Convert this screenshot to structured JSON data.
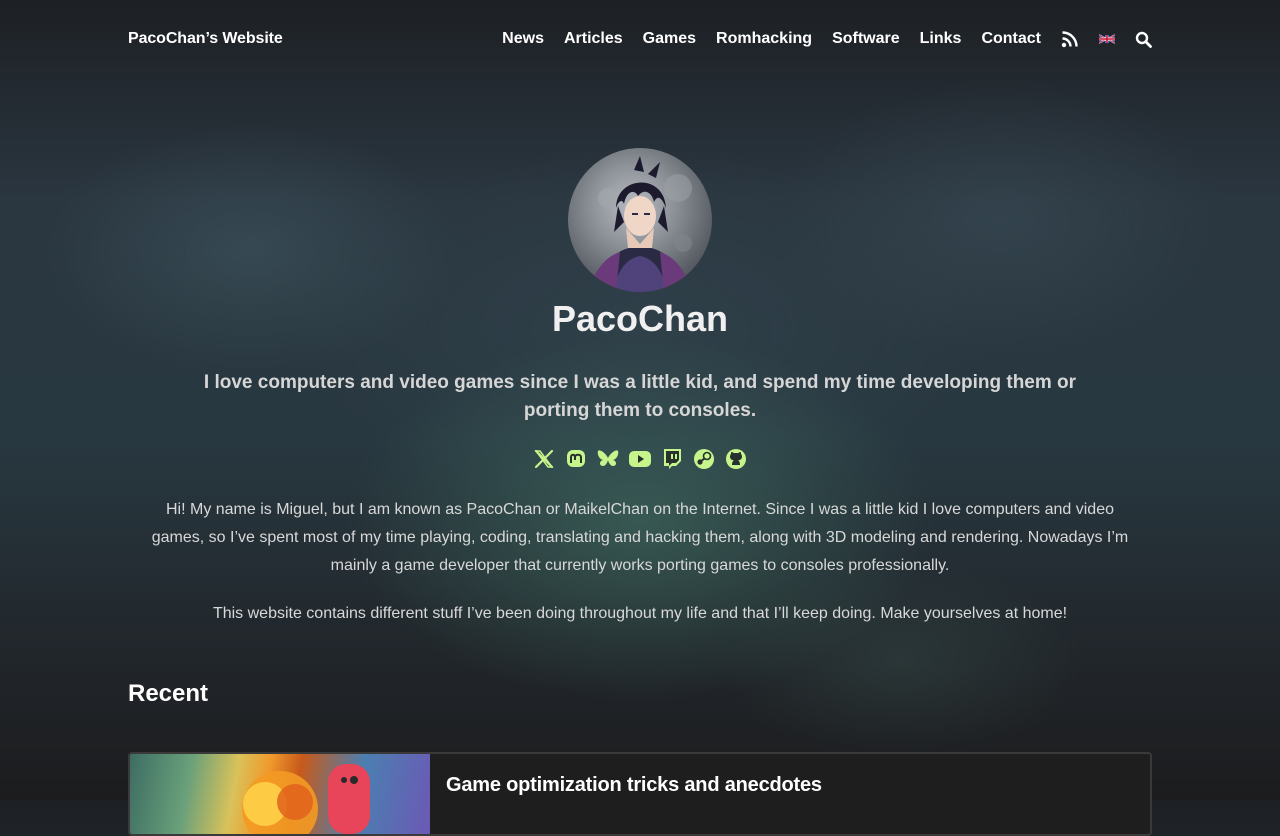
{
  "header": {
    "brand": "PacoChan’s Website",
    "nav": [
      {
        "label": "News"
      },
      {
        "label": "Articles"
      },
      {
        "label": "Games"
      },
      {
        "label": "Romhacking"
      },
      {
        "label": "Software"
      },
      {
        "label": "Links"
      },
      {
        "label": "Contact"
      }
    ],
    "icons": [
      "rss-icon",
      "uk-flag-icon",
      "search-icon"
    ]
  },
  "profile": {
    "name": "PacoChan",
    "tagline": "I love computers and video games since I was a little kid, and spend my time developing them or porting them to consoles.",
    "social_icons": [
      "x-icon",
      "mastodon-icon",
      "bluesky-icon",
      "youtube-icon",
      "twitch-icon",
      "steam-icon",
      "github-icon"
    ],
    "bio": "Hi! My name is Miguel, but I am known as PacoChan or MaikelChan on the Internet. Since I was a little kid I love computers and video games, so I’ve spent most of my time playing, coding, translating and hacking them, along with 3D modeling and rendering. Nowadays I’m mainly a game developer that currently works porting games to consoles professionally.",
    "bio2": "This website contains different stuff I’ve been doing throughout my life and that I’ll keep doing. Make yourselves at home!"
  },
  "recent": {
    "heading": "Recent",
    "items": [
      {
        "title": "Game optimization tricks and anecdotes"
      }
    ]
  },
  "colors": {
    "accent": "#c6f58b",
    "text": "#ececec"
  }
}
